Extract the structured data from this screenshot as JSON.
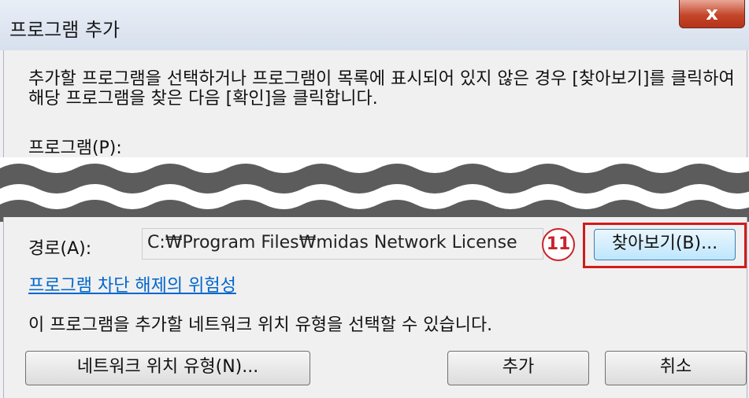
{
  "window": {
    "title": "프로그램 추가",
    "close_glyph": "x"
  },
  "description": "추가할 프로그램을 선택하거나 프로그램이 목록에 표시되어 있지 않은 경우 [찾아보기]를 클릭하여 해당 프로그램을 찾은 다음 [확인]을 클릭합니다.",
  "program_label": "프로그램(P):",
  "path": {
    "label": "경로(A):",
    "value": "C:₩Program Files₩midas Network License"
  },
  "step_badge": "11",
  "browse_label": "찾아보기(B)...",
  "risk_link": "프로그램 차단 해제의 위험성",
  "info_text": "이 프로그램을 추가할 네트워크 위치 유형을 선택할 수 있습니다.",
  "buttons": {
    "network_location": "네트워크 위치 유형(N)...",
    "add": "추가",
    "cancel": "취소"
  },
  "colors": {
    "highlight": "#d11b1b",
    "link": "#0066cc",
    "close": "#c4462a"
  }
}
